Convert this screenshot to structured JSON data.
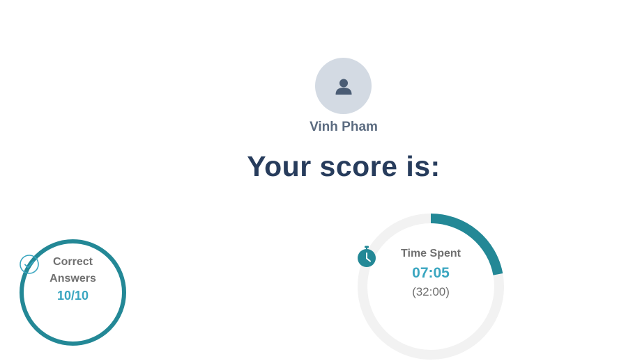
{
  "user": {
    "name": "Vinh Pham",
    "avatar_icon": "user-icon"
  },
  "heading": "Your score is:",
  "correct_answers": {
    "icon": "check-circle-icon",
    "label": "Correct Answers",
    "value": "10/10",
    "progress_fraction": 1.0
  },
  "time_spent": {
    "icon": "stopwatch-icon",
    "label": "Time Spent",
    "value": "07:05",
    "limit": "(32:00)",
    "progress_fraction": 0.221
  },
  "colors": {
    "accent": "#238896",
    "value_text": "#3aa6c0",
    "heading": "#273c5c",
    "track": "#f2f2f2",
    "avatar_bg": "#d3dae3"
  }
}
